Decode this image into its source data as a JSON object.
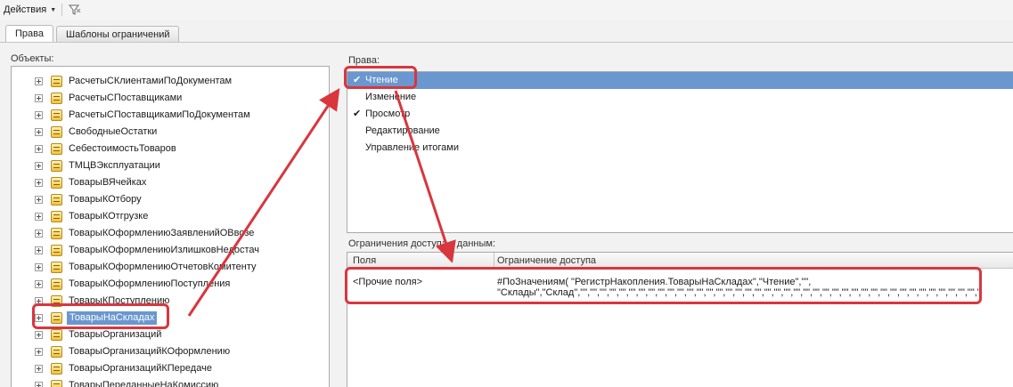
{
  "toolbar": {
    "actions_label": "Действия",
    "filter_icon": "filter-icon"
  },
  "tabs": [
    {
      "label": "Права"
    },
    {
      "label": "Шаблоны ограничений"
    }
  ],
  "objects": {
    "label": "Объекты:",
    "items": [
      "РасчетыСКлиентамиПоДокументам",
      "РасчетыСПоставщиками",
      "РасчетыСПоставщикамиПоДокументам",
      "СвободныеОстатки",
      "СебестоимостьТоваров",
      "ТМЦВЭксплуатации",
      "ТоварыВЯчейках",
      "ТоварыКОтбору",
      "ТоварыКОтгрузке",
      "ТоварыКОформлениюЗаявленийОВвозе",
      "ТоварыКОформлениюИзлишковНедостач",
      "ТоварыКОформлениюОтчетовКомитенту",
      "ТоварыКОформлениюПоступления",
      "ТоварыКПоступлению",
      "ТоварыНаСкладах",
      "ТоварыОрганизаций",
      "ТоварыОрганизацийКОформлению",
      "ТоварыОрганизацийКПередаче",
      "ТоварыПереданныеНаКомиссию"
    ]
  },
  "rights": {
    "label": "Права:",
    "items": [
      {
        "label": "Чтение",
        "checked": true,
        "selected": true
      },
      {
        "label": "Изменение",
        "checked": false,
        "selected": false
      },
      {
        "label": "Просмотр",
        "checked": true,
        "selected": false
      },
      {
        "label": "Редактирование",
        "checked": false,
        "selected": false
      },
      {
        "label": "Управление итогами",
        "checked": false,
        "selected": false
      }
    ]
  },
  "restrictions": {
    "label": "Ограничения доступа к данным:",
    "col_fields": "Поля",
    "col_restriction": "Ограничение доступа",
    "row_field": "<Прочие поля>",
    "row_line1": "#ПоЗначениям( \"РегистрНакопления.ТоварыНаСкладах\",\"Чтение\",\"\",",
    "row_line2": "\"Склады\",\"Склад\",\"\",\"\",\"\",\"\",\"\",\"\",\"\",\"\",\"\",\"\",\"\",\"\",\"\",\"\",\"\",\"\",\"\",\"\",\"\",\"\",\"\",\"\",\"\",\"\",\"\",\"\",\"\",\"\",\"\",\"\",\"\",\"\",\"\",\"\",\"\",\"\",\"\",\"\",\"\",\"\",\"\",\"\",\"\",\"\",\"\" )"
  },
  "annotation_color": "#d9363e",
  "selection_color": "#6a97cf"
}
